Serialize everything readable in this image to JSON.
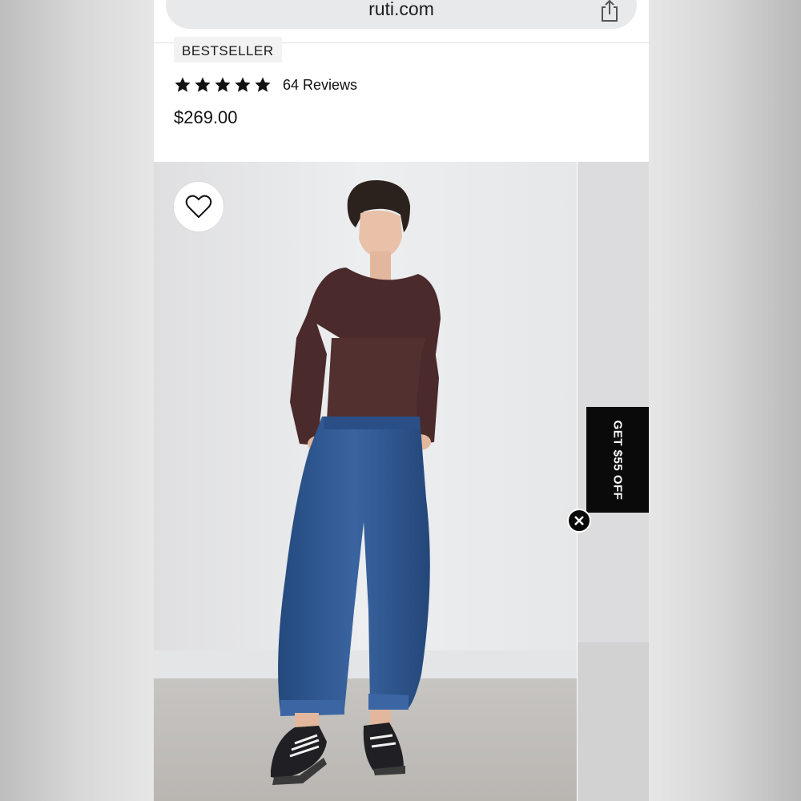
{
  "browser": {
    "url": "ruti.com",
    "share_icon": "share-icon"
  },
  "product": {
    "badge": "BESTSELLER",
    "rating_stars": 5,
    "reviews_label": "64 Reviews",
    "price": "$269.00"
  },
  "gallery": {
    "wishlist_icon": "heart-icon"
  },
  "promo": {
    "label": "GET $55 OFF",
    "close_icon": "close-icon"
  },
  "colors": {
    "promo_background": "#0a0a0a",
    "url_bar": "#e8e9eb",
    "badge_background": "#f2f2f2",
    "top_color": "#4b2a2b",
    "jeans_color": "#2e5489"
  }
}
